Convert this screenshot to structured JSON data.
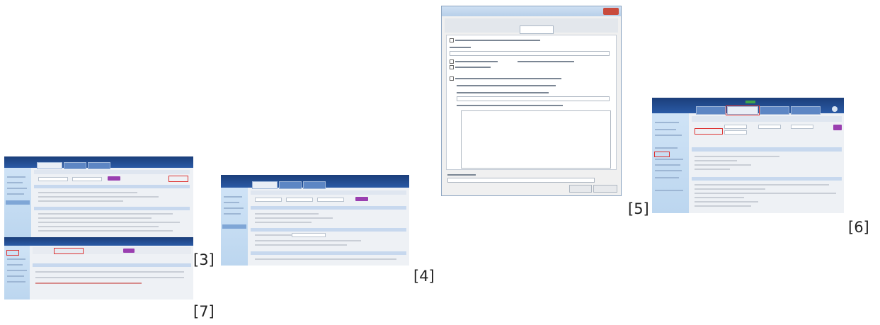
{
  "labels": {
    "thumb3": "[3]",
    "thumb4": "[4]",
    "thumb5": "[5]",
    "thumb6": "[6]",
    "thumb7": "[7]"
  },
  "colors": {
    "topbar": "#1b3e7a",
    "sidebar": "#cfe3f6",
    "accent_button": "#9a3fb0",
    "highlight": "#dd3333"
  },
  "icons": {
    "dialog_close": "close-icon"
  }
}
